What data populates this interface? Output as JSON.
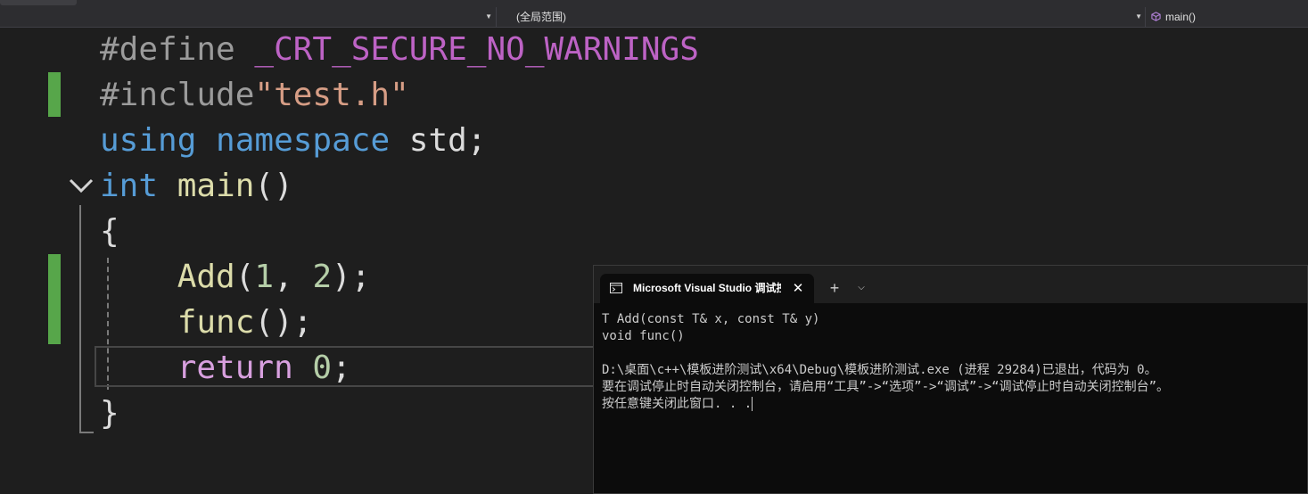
{
  "navbar": {
    "scope": "(全局范围)",
    "function": "main()"
  },
  "editor": {
    "lines": [
      {
        "tokens": [
          {
            "t": "#define ",
            "c": "pp"
          },
          {
            "t": "_CRT_SECURE_NO_WARNINGS",
            "c": "macro"
          }
        ]
      },
      {
        "tokens": [
          {
            "t": "#include",
            "c": "pp"
          },
          {
            "t": "\"test.h\"",
            "c": "str"
          }
        ]
      },
      {
        "tokens": [
          {
            "t": "using ",
            "c": "kw"
          },
          {
            "t": "namespace ",
            "c": "kw"
          },
          {
            "t": "std;",
            "c": "plain"
          }
        ]
      },
      {
        "tokens": [
          {
            "t": "int ",
            "c": "kw"
          },
          {
            "t": "main",
            "c": "fn"
          },
          {
            "t": "()",
            "c": "plain"
          }
        ]
      },
      {
        "tokens": [
          {
            "t": "{",
            "c": "plain"
          }
        ]
      },
      {
        "tokens": [
          {
            "t": "    ",
            "c": "plain"
          },
          {
            "t": "Add",
            "c": "fn"
          },
          {
            "t": "(",
            "c": "plain"
          },
          {
            "t": "1",
            "c": "num"
          },
          {
            "t": ", ",
            "c": "plain"
          },
          {
            "t": "2",
            "c": "num"
          },
          {
            "t": ");",
            "c": "plain"
          }
        ]
      },
      {
        "tokens": [
          {
            "t": "    ",
            "c": "plain"
          },
          {
            "t": "func",
            "c": "fn"
          },
          {
            "t": "();",
            "c": "plain"
          }
        ]
      },
      {
        "tokens": [
          {
            "t": "    ",
            "c": "plain"
          },
          {
            "t": "return ",
            "c": "ctl"
          },
          {
            "t": "0",
            "c": "num"
          },
          {
            "t": ";",
            "c": "plain"
          }
        ]
      },
      {
        "tokens": [
          {
            "t": "}",
            "c": "plain"
          }
        ]
      }
    ]
  },
  "console": {
    "title": "Microsoft Visual Studio 调试控制台",
    "output": [
      "T Add(const T& x, const T& y)",
      "void func()",
      "",
      "D:\\桌面\\c++\\模板进阶测试\\x64\\Debug\\模板进阶测试.exe (进程 29284)已退出，代码为 0。",
      "要在调试停止时自动关闭控制台，请启用“工具”->“选项”->“调试”->“调试停止时自动关闭控制台”。",
      "按任意键关闭此窗口. . ."
    ]
  },
  "colors": {
    "editor_bg": "#1e1e1e",
    "keyword": "#569cd6",
    "function": "#dcdcaa",
    "macro": "#bd63c5",
    "string": "#d69d85",
    "number": "#b5cea8",
    "control_keyword": "#d8a0df",
    "change_marker": "#57a64a",
    "console_bg": "#0c0c0c"
  },
  "icons": {
    "fold": "chevron-down-icon",
    "function_member": "cube-icon",
    "console": "command-prompt-icon",
    "close": "close-icon",
    "new_tab": "plus-icon",
    "dropdown": "chevron-down-icon"
  }
}
